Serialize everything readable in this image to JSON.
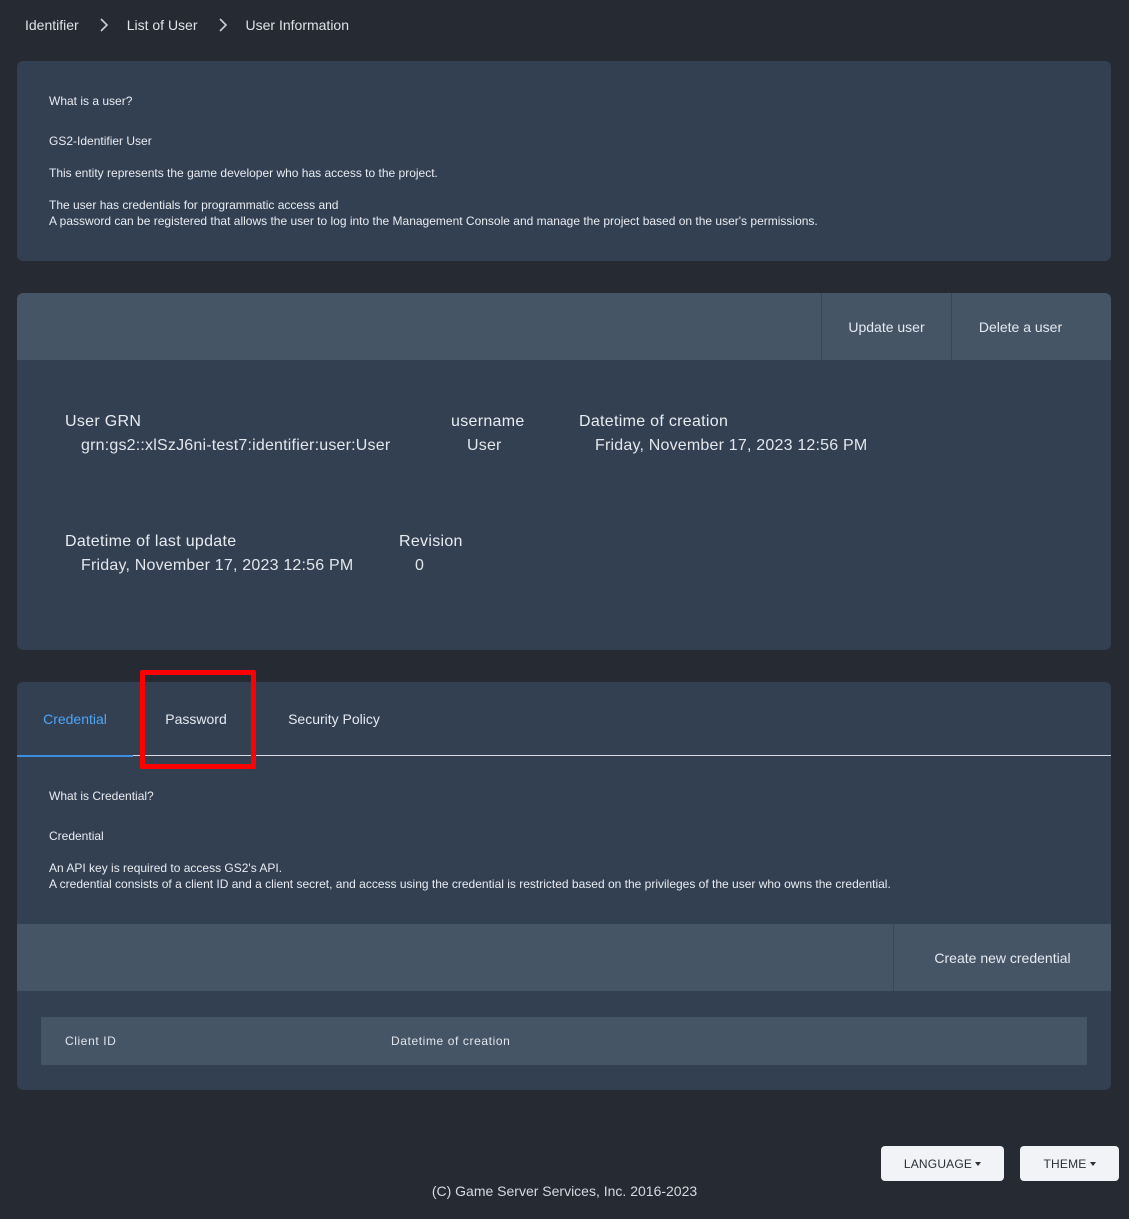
{
  "breadcrumb": [
    "Identifier",
    "List of User",
    "User Information"
  ],
  "intro": {
    "title": "What is a user?",
    "subtitle": "GS2-Identifier User",
    "p1": "This entity represents the game developer who has access to the project.",
    "p2a": "The user has credentials for programmatic access and",
    "p2b": "A password can be registered that allows the user to log into the Management Console and manage the project based on the user's permissions."
  },
  "toolbar": {
    "update_label": "Update user",
    "delete_label": "Delete a user"
  },
  "user": {
    "grn_label": "User GRN",
    "grn_value": "grn:gs2::xlSzJ6ni-test7:identifier:user:User",
    "username_label": "username",
    "username_value": "User",
    "created_label": "Datetime of creation",
    "created_value": "Friday, November 17, 2023 12:56 PM",
    "updated_label": "Datetime of last update",
    "updated_value": "Friday, November 17, 2023 12:56 PM",
    "revision_label": "Revision",
    "revision_value": "0"
  },
  "tabs": [
    {
      "label": "Credential",
      "active": true
    },
    {
      "label": "Password",
      "active": false
    },
    {
      "label": "Security Policy",
      "active": false
    }
  ],
  "credential": {
    "title": "What is Credential?",
    "subtitle": "Credential",
    "p1": "An API key is required to access GS2's API.",
    "p2": "A credential consists of a client ID and a client secret, and access using the credential is restricted based on the privileges of the user who owns the credential.",
    "create_label": "Create new credential",
    "table_headers": [
      "Client ID",
      "Datetime of creation"
    ]
  },
  "footer": {
    "language_label": "LANGUAGE",
    "theme_label": "THEME",
    "copyright": "(C) Game Server Services, Inc. 2016-2023"
  },
  "colors": {
    "background": "#252a33",
    "card": "#334052",
    "toolbar": "#465566",
    "accent": "#4ea4f6",
    "highlight": "#ff0000"
  }
}
